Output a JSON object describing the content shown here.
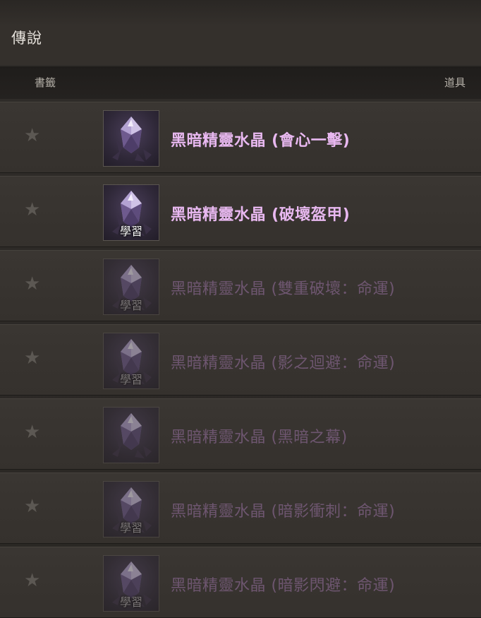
{
  "section": {
    "title": "傳說"
  },
  "columns": {
    "bookmark": "書籤",
    "item": "道具"
  },
  "icons": {
    "bookmark": "star-icon",
    "item": "dark-crystal-icon"
  },
  "colors": {
    "active_name": "#e8b8f0",
    "inactive_name": "#6e5670",
    "star": "#5c5853"
  },
  "items": [
    {
      "star": "★",
      "name": "黑暗精靈水晶 (會心一擊)",
      "badge": "",
      "active": true
    },
    {
      "star": "★",
      "name": "黑暗精靈水晶 (破壞盔甲)",
      "badge": "學習",
      "active": true
    },
    {
      "star": "★",
      "name": "黑暗精靈水晶 (雙重破壞：命運)",
      "badge": "學習",
      "active": false
    },
    {
      "star": "★",
      "name": "黑暗精靈水晶 (影之迴避：命運)",
      "badge": "學習",
      "active": false
    },
    {
      "star": "★",
      "name": "黑暗精靈水晶 (黑暗之幕)",
      "badge": "",
      "active": false
    },
    {
      "star": "★",
      "name": "黑暗精靈水晶 (暗影衝刺：命運)",
      "badge": "學習",
      "active": false
    },
    {
      "star": "★",
      "name": "黑暗精靈水晶 (暗影閃避：命運)",
      "badge": "學習",
      "active": false
    }
  ]
}
